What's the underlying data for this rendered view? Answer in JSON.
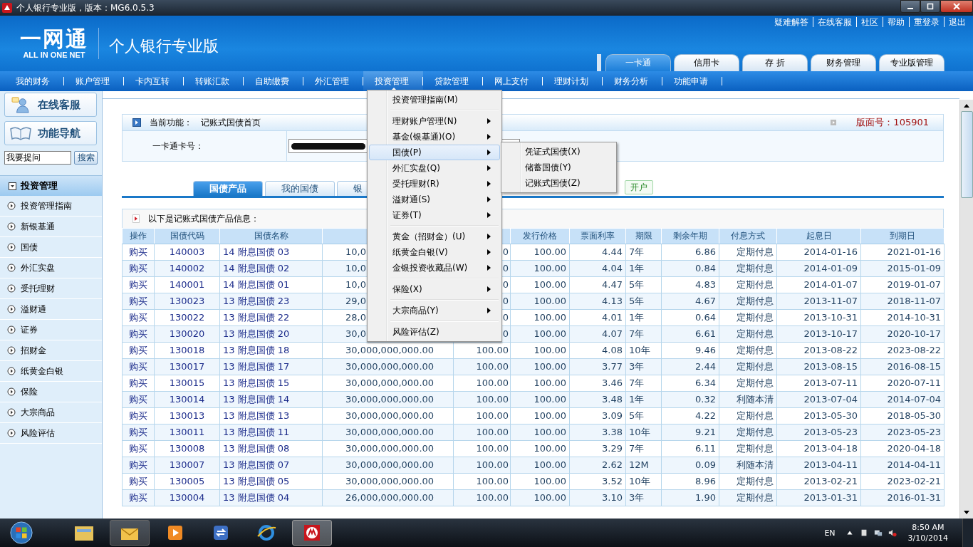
{
  "window": {
    "title": "个人银行专业版，版本：MG6.0.5.3"
  },
  "header": {
    "logo_text": "一网通",
    "logo_subtitle": "ALL IN ONE NET",
    "product": "个人银行专业版",
    "links": [
      "疑难解答",
      "在线客服",
      "社区",
      "帮助",
      "重登录",
      "退出"
    ],
    "tabs": [
      {
        "label": "一卡通",
        "selected": true
      },
      {
        "label": "信用卡",
        "selected": false
      },
      {
        "label": "存 折",
        "selected": false
      },
      {
        "label": "财务管理",
        "selected": false
      },
      {
        "label": "专业版管理",
        "selected": false
      }
    ]
  },
  "nav": [
    {
      "label": "我的财务",
      "selected": false
    },
    {
      "label": "账户管理",
      "selected": false
    },
    {
      "label": "卡内互转",
      "selected": false
    },
    {
      "label": "转账汇款",
      "selected": false
    },
    {
      "label": "自助缴费",
      "selected": false
    },
    {
      "label": "外汇管理",
      "selected": false
    },
    {
      "label": "投资管理",
      "selected": true
    },
    {
      "label": "贷款管理",
      "selected": false
    },
    {
      "label": "网上支付",
      "selected": false
    },
    {
      "label": "理财计划",
      "selected": false
    },
    {
      "label": "财务分析",
      "selected": false
    },
    {
      "label": "功能申请",
      "selected": false
    }
  ],
  "sidebar": {
    "service_button": "在线客服",
    "guide_button": "功能导航",
    "question": {
      "value": "我要提问"
    },
    "search_button": "搜索",
    "section": {
      "label": "投资管理",
      "expanded": true
    },
    "items": [
      "投资管理指南",
      "新银基通",
      "国债",
      "外汇实盘",
      "受托理财",
      "溢财通",
      "证券",
      "招财金",
      "纸黄金白银",
      "保险",
      "大宗商品",
      "风险评估"
    ]
  },
  "breadcrumb": {
    "label": "当前功能：",
    "value": "记账式国债首页",
    "page_number": "版面号：105901"
  },
  "card": {
    "label": "一卡通卡号："
  },
  "sub_tabs": [
    {
      "label": "国债产品",
      "selected": true
    },
    {
      "label": "我的国债",
      "selected": false
    },
    {
      "label": "银",
      "selected": false
    }
  ],
  "open_account": "开户",
  "info": "以下是记账式国债产品信息：",
  "table": {
    "columns": [
      {
        "label": "操作"
      },
      {
        "label": "国债代码"
      },
      {
        "label": "国债名称"
      },
      {},
      {},
      {
        "label": "发行价格"
      },
      {
        "label": "票面利率"
      },
      {
        "label": "期限"
      },
      {
        "label": "剩余年期"
      },
      {
        "label": "付息方式"
      },
      {
        "label": "起息日"
      },
      {
        "label": "到期日"
      }
    ],
    "rows": [
      [
        "购买",
        "140003",
        "14 附息国债 03",
        "10,0",
        "0",
        "100.00",
        "4.44",
        "7年",
        "6.86",
        "定期付息",
        "2014-01-16",
        "2021-01-16"
      ],
      [
        "购买",
        "140002",
        "14 附息国债 02",
        "10,0",
        "0",
        "100.00",
        "4.04",
        "1年",
        "0.84",
        "定期付息",
        "2014-01-09",
        "2015-01-09"
      ],
      [
        "购买",
        "140001",
        "14 附息国债 01",
        "10,0",
        "0",
        "100.00",
        "4.47",
        "5年",
        "4.83",
        "定期付息",
        "2014-01-07",
        "2019-01-07"
      ],
      [
        "购买",
        "130023",
        "13 附息国债 23",
        "29,0",
        "0",
        "100.00",
        "4.13",
        "5年",
        "4.67",
        "定期付息",
        "2013-11-07",
        "2018-11-07"
      ],
      [
        "购买",
        "130022",
        "13 附息国债 22",
        "28,0",
        "0",
        "100.00",
        "4.01",
        "1年",
        "0.64",
        "定期付息",
        "2013-10-31",
        "2014-10-31"
      ],
      [
        "购买",
        "130020",
        "13 附息国债 20",
        "30,0",
        "0",
        "100.00",
        "4.07",
        "7年",
        "6.61",
        "定期付息",
        "2013-10-17",
        "2020-10-17"
      ],
      [
        "购买",
        "130018",
        "13 附息国债 18",
        "30,000,000,000.00",
        "100.00",
        "100.00",
        "4.08",
        "10年",
        "9.46",
        "定期付息",
        "2013-08-22",
        "2023-08-22"
      ],
      [
        "购买",
        "130017",
        "13 附息国债 17",
        "30,000,000,000.00",
        "100.00",
        "100.00",
        "3.77",
        "3年",
        "2.44",
        "定期付息",
        "2013-08-15",
        "2016-08-15"
      ],
      [
        "购买",
        "130015",
        "13 附息国债 15",
        "30,000,000,000.00",
        "100.00",
        "100.00",
        "3.46",
        "7年",
        "6.34",
        "定期付息",
        "2013-07-11",
        "2020-07-11"
      ],
      [
        "购买",
        "130014",
        "13 附息国债 14",
        "30,000,000,000.00",
        "100.00",
        "100.00",
        "3.48",
        "1年",
        "0.32",
        "利随本清",
        "2013-07-04",
        "2014-07-04"
      ],
      [
        "购买",
        "130013",
        "13 附息国债 13",
        "30,000,000,000.00",
        "100.00",
        "100.00",
        "3.09",
        "5年",
        "4.22",
        "定期付息",
        "2013-05-30",
        "2018-05-30"
      ],
      [
        "购买",
        "130011",
        "13 附息国债 11",
        "30,000,000,000.00",
        "100.00",
        "100.00",
        "3.38",
        "10年",
        "9.21",
        "定期付息",
        "2013-05-23",
        "2023-05-23"
      ],
      [
        "购买",
        "130008",
        "13 附息国债 08",
        "30,000,000,000.00",
        "100.00",
        "100.00",
        "3.29",
        "7年",
        "6.11",
        "定期付息",
        "2013-04-18",
        "2020-04-18"
      ],
      [
        "购买",
        "130007",
        "13 附息国债 07",
        "30,000,000,000.00",
        "100.00",
        "100.00",
        "2.62",
        "12M",
        "0.09",
        "利随本清",
        "2013-04-11",
        "2014-04-11"
      ],
      [
        "购买",
        "130005",
        "13 附息国债 05",
        "30,000,000,000.00",
        "100.00",
        "100.00",
        "3.52",
        "10年",
        "8.96",
        "定期付息",
        "2013-02-21",
        "2023-02-21"
      ],
      [
        "购买",
        "130004",
        "13 附息国债 04",
        "26,000,000,000.00",
        "100.00",
        "100.00",
        "3.10",
        "3年",
        "1.90",
        "定期付息",
        "2013-01-31",
        "2016-01-31"
      ]
    ]
  },
  "menu": [
    {
      "kind": "item",
      "label": "投资管理指南(M)",
      "submenu": false,
      "selected": false
    },
    {
      "kind": "separator"
    },
    {
      "kind": "item",
      "label": "理财账户管理(N)",
      "submenu": true,
      "selected": false
    },
    {
      "kind": "item",
      "label": "基金(银基通)(O)",
      "submenu": true,
      "selected": false
    },
    {
      "kind": "item",
      "label": "国债(P)",
      "submenu": true,
      "selected": true
    },
    {
      "kind": "item",
      "label": "外汇实盘(Q)",
      "submenu": true,
      "selected": false
    },
    {
      "kind": "item",
      "label": "受托理财(R)",
      "submenu": true,
      "selected": false
    },
    {
      "kind": "item",
      "label": "溢财通(S)",
      "submenu": true,
      "selected": false
    },
    {
      "kind": "item",
      "label": "证券(T)",
      "submenu": true,
      "selected": false
    },
    {
      "kind": "separator"
    },
    {
      "kind": "item",
      "label": "黄金（招财金）(U)",
      "submenu": true,
      "selected": false
    },
    {
      "kind": "item",
      "label": "纸黄金白银(V)",
      "submenu": true,
      "selected": false
    },
    {
      "kind": "item",
      "label": "金银投资收藏品(W)",
      "submenu": true,
      "selected": false
    },
    {
      "kind": "separator"
    },
    {
      "kind": "item",
      "label": "保险(X)",
      "submenu": true,
      "selected": false
    },
    {
      "kind": "separator"
    },
    {
      "kind": "item",
      "label": "大宗商品(Y)",
      "submenu": true,
      "selected": false
    },
    {
      "kind": "separator"
    },
    {
      "kind": "item",
      "label": "风险评估(Z)",
      "submenu": false,
      "selected": false
    }
  ],
  "submenu": [
    "凭证式国债(X)",
    "储蓄国债(Y)",
    "记账式国债(Z)"
  ],
  "taskbar": {
    "language": "EN",
    "time": "8:50 AM",
    "date": "3/10/2014"
  }
}
